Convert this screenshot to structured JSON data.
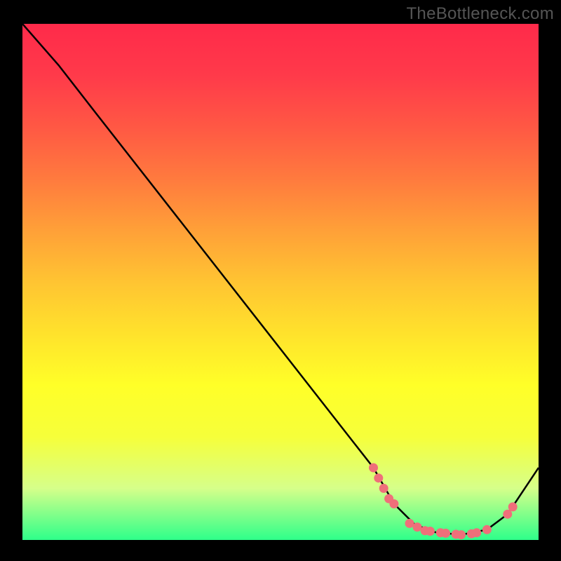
{
  "watermark": "TheBottleneck.com",
  "chart_data": {
    "type": "line",
    "title": "",
    "xlabel": "",
    "ylabel": "",
    "xlim": [
      0,
      100
    ],
    "ylim": [
      0,
      100
    ],
    "curve": [
      {
        "x": 0,
        "y": 100
      },
      {
        "x": 7,
        "y": 92
      },
      {
        "x": 14,
        "y": 83
      },
      {
        "x": 68,
        "y": 14
      },
      {
        "x": 72,
        "y": 7
      },
      {
        "x": 76,
        "y": 3
      },
      {
        "x": 80,
        "y": 1.5
      },
      {
        "x": 85,
        "y": 1
      },
      {
        "x": 90,
        "y": 2
      },
      {
        "x": 94,
        "y": 5
      },
      {
        "x": 100,
        "y": 14
      }
    ],
    "markers": [
      {
        "x": 68,
        "y": 14
      },
      {
        "x": 69,
        "y": 12
      },
      {
        "x": 70,
        "y": 10
      },
      {
        "x": 71,
        "y": 8
      },
      {
        "x": 72,
        "y": 7
      },
      {
        "x": 75,
        "y": 3.2
      },
      {
        "x": 76.5,
        "y": 2.5
      },
      {
        "x": 78,
        "y": 1.8
      },
      {
        "x": 79,
        "y": 1.7
      },
      {
        "x": 81,
        "y": 1.4
      },
      {
        "x": 82,
        "y": 1.3
      },
      {
        "x": 84,
        "y": 1.1
      },
      {
        "x": 85,
        "y": 1.0
      },
      {
        "x": 87,
        "y": 1.2
      },
      {
        "x": 88,
        "y": 1.4
      },
      {
        "x": 90,
        "y": 2
      },
      {
        "x": 94,
        "y": 5
      },
      {
        "x": 95,
        "y": 6.4
      }
    ],
    "marker_color": "#ef6f7a",
    "line_color": "#000000",
    "gradient_colors": {
      "top": "#ff2a4a",
      "mid": "#ffe22c",
      "bottom": "#2eff8a"
    }
  }
}
